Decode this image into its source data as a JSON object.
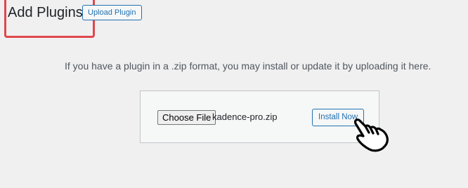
{
  "header": {
    "title": "Add Plugins",
    "upload_button_label": "Upload Plugin"
  },
  "upload": {
    "help_text": "If you have a plugin in a .zip format, you may install or update it by uploading it here.",
    "choose_file_label": "Choose File",
    "selected_file": "kadence-pro.zip",
    "install_button_label": "Install Now"
  },
  "annotation": {
    "highlight_color": "#e0474c",
    "cursor_icon": "pointer-hand-icon"
  },
  "colors": {
    "accent": "#2271b1",
    "background": "#f0f0f1"
  }
}
